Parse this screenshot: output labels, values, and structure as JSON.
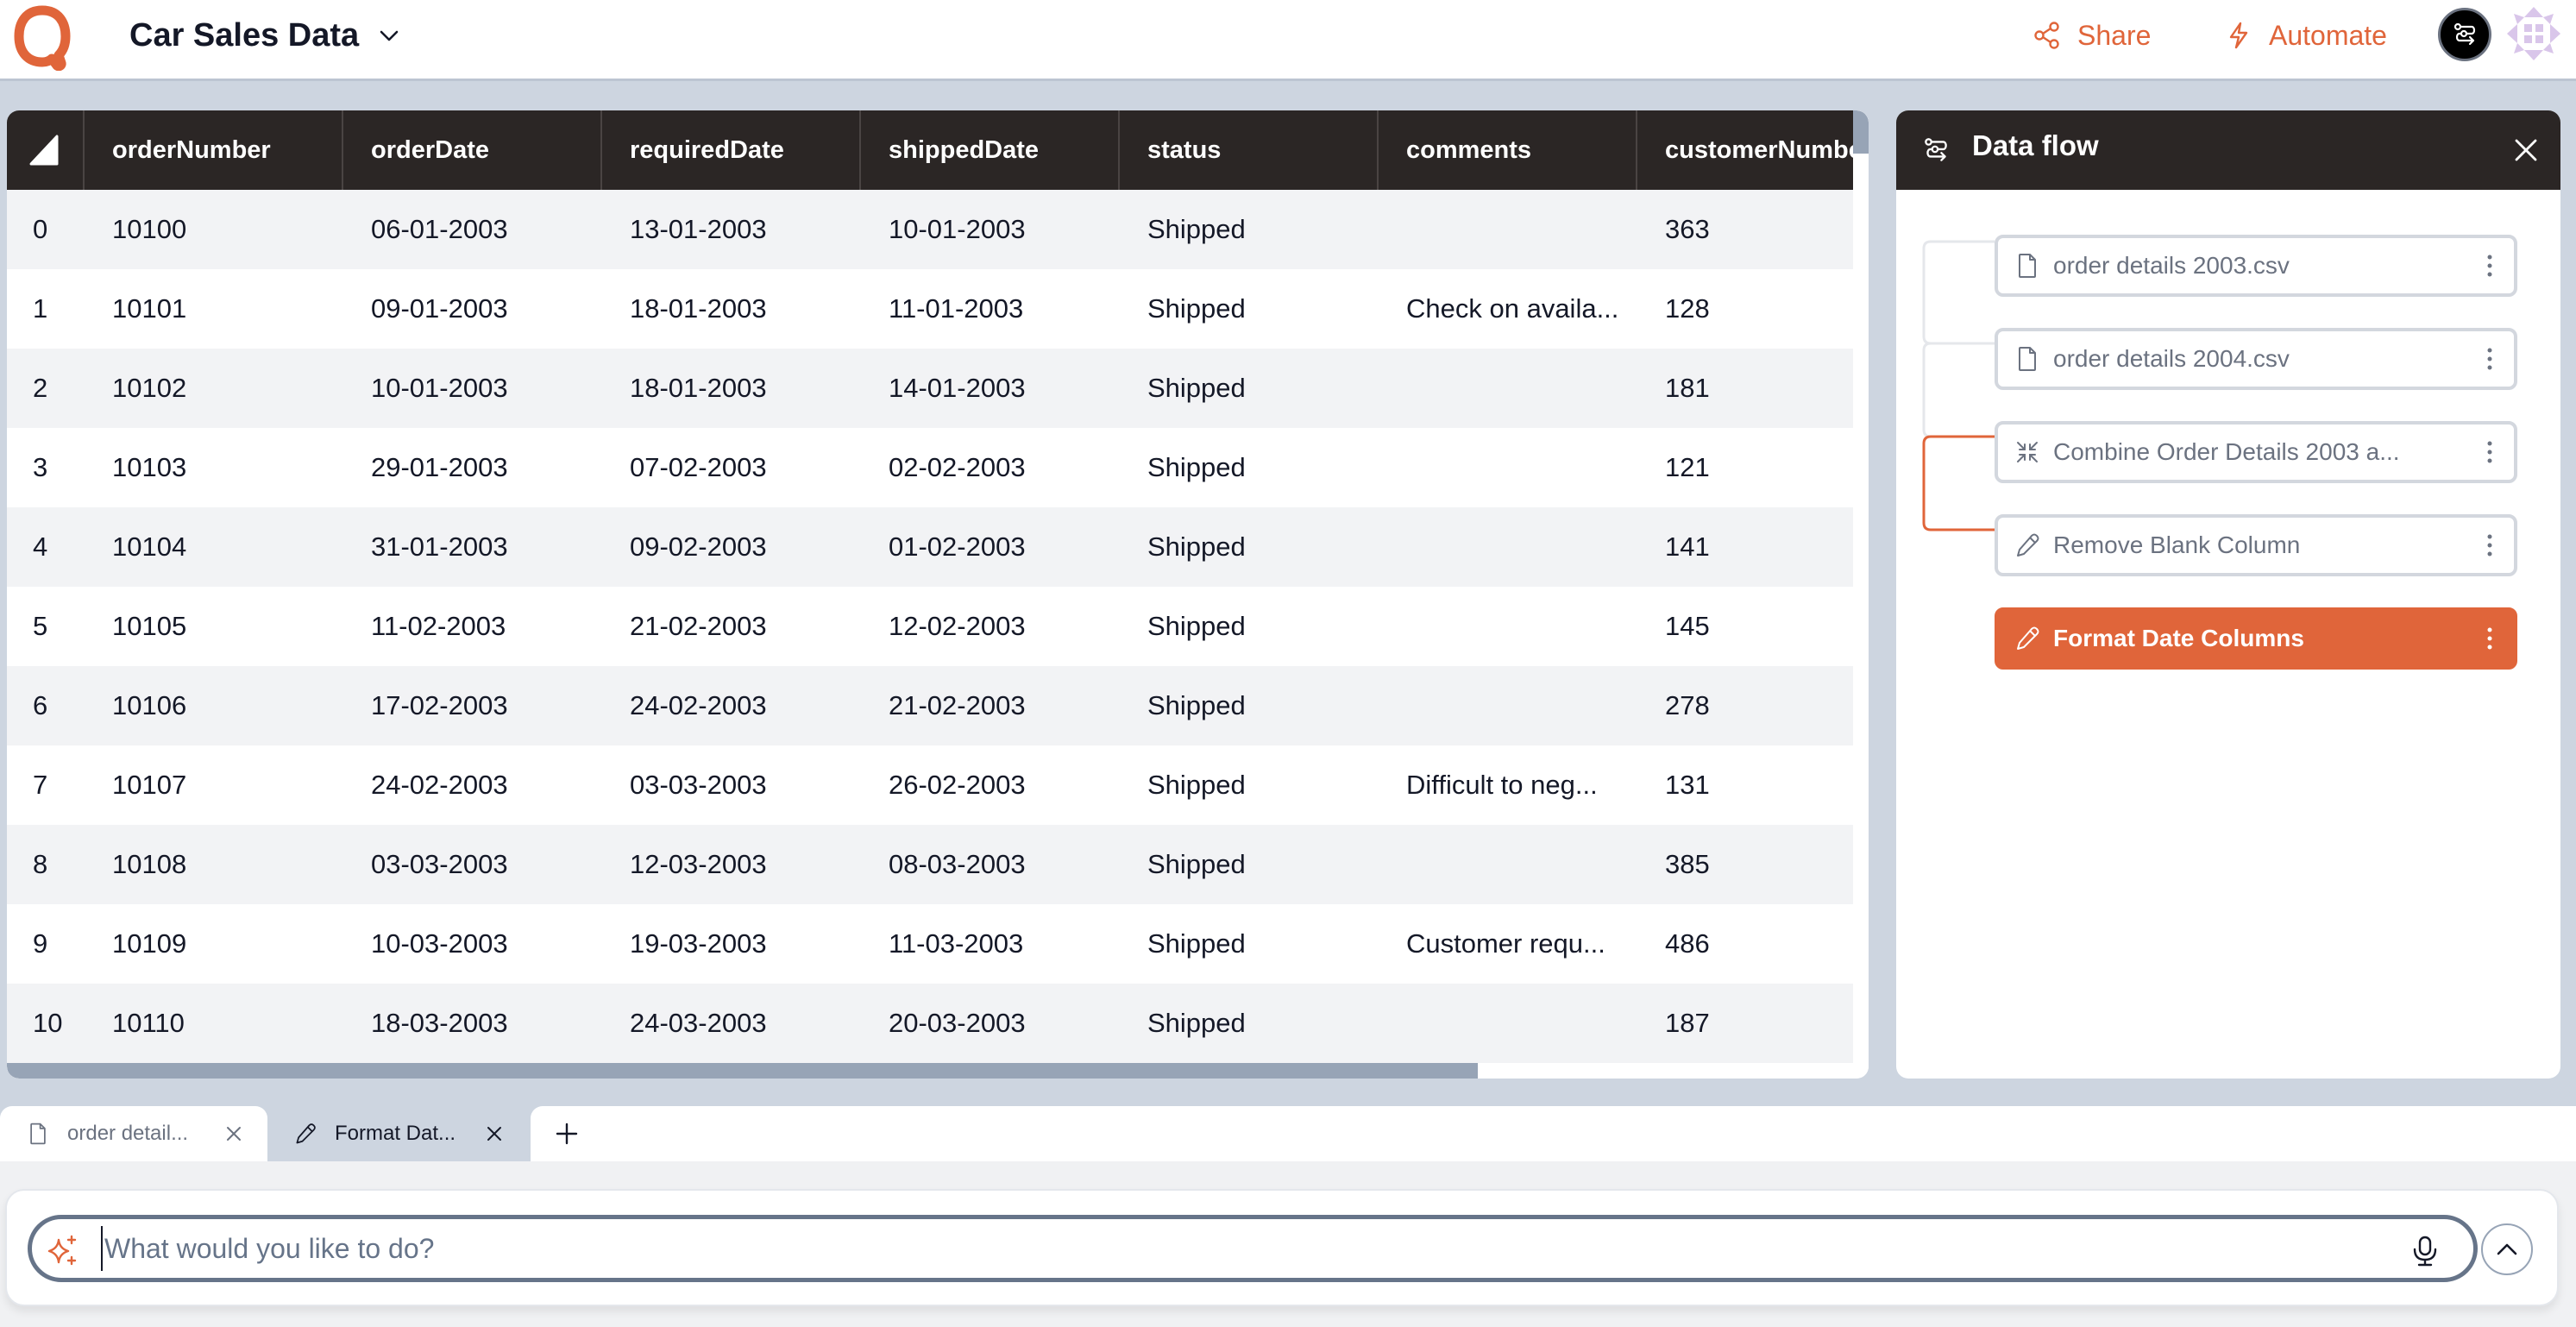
{
  "header": {
    "title": "Car Sales Data",
    "share_label": "Share",
    "automate_label": "Automate"
  },
  "colors": {
    "accent": "#e0653a",
    "header_dark": "#2b2625",
    "row_alt": "#f2f3f5",
    "page_bg": "#cdd5e0"
  },
  "table": {
    "columns": [
      "orderNumber",
      "orderDate",
      "requiredDate",
      "shippedDate",
      "status",
      "comments",
      "customerNumber"
    ],
    "rows": [
      {
        "index": "0",
        "orderNumber": "10100",
        "orderDate": "06-01-2003",
        "requiredDate": "13-01-2003",
        "shippedDate": "10-01-2003",
        "status": "Shipped",
        "comments": "",
        "customerNumber": "363"
      },
      {
        "index": "1",
        "orderNumber": "10101",
        "orderDate": "09-01-2003",
        "requiredDate": "18-01-2003",
        "shippedDate": "11-01-2003",
        "status": "Shipped",
        "comments": "Check on availa...",
        "customerNumber": "128"
      },
      {
        "index": "2",
        "orderNumber": "10102",
        "orderDate": "10-01-2003",
        "requiredDate": "18-01-2003",
        "shippedDate": "14-01-2003",
        "status": "Shipped",
        "comments": "",
        "customerNumber": "181"
      },
      {
        "index": "3",
        "orderNumber": "10103",
        "orderDate": "29-01-2003",
        "requiredDate": "07-02-2003",
        "shippedDate": "02-02-2003",
        "status": "Shipped",
        "comments": "",
        "customerNumber": "121"
      },
      {
        "index": "4",
        "orderNumber": "10104",
        "orderDate": "31-01-2003",
        "requiredDate": "09-02-2003",
        "shippedDate": "01-02-2003",
        "status": "Shipped",
        "comments": "",
        "customerNumber": "141"
      },
      {
        "index": "5",
        "orderNumber": "10105",
        "orderDate": "11-02-2003",
        "requiredDate": "21-02-2003",
        "shippedDate": "12-02-2003",
        "status": "Shipped",
        "comments": "",
        "customerNumber": "145"
      },
      {
        "index": "6",
        "orderNumber": "10106",
        "orderDate": "17-02-2003",
        "requiredDate": "24-02-2003",
        "shippedDate": "21-02-2003",
        "status": "Shipped",
        "comments": "",
        "customerNumber": "278"
      },
      {
        "index": "7",
        "orderNumber": "10107",
        "orderDate": "24-02-2003",
        "requiredDate": "03-03-2003",
        "shippedDate": "26-02-2003",
        "status": "Shipped",
        "comments": "Difficult to neg...",
        "customerNumber": "131"
      },
      {
        "index": "8",
        "orderNumber": "10108",
        "orderDate": "03-03-2003",
        "requiredDate": "12-03-2003",
        "shippedDate": "08-03-2003",
        "status": "Shipped",
        "comments": "",
        "customerNumber": "385"
      },
      {
        "index": "9",
        "orderNumber": "10109",
        "orderDate": "10-03-2003",
        "requiredDate": "19-03-2003",
        "shippedDate": "11-03-2003",
        "status": "Shipped",
        "comments": "Customer requ...",
        "customerNumber": "486"
      },
      {
        "index": "10",
        "orderNumber": "10110",
        "orderDate": "18-03-2003",
        "requiredDate": "24-03-2003",
        "shippedDate": "20-03-2003",
        "status": "Shipped",
        "comments": "",
        "customerNumber": "187"
      }
    ]
  },
  "data_flow": {
    "title": "Data flow",
    "nodes": [
      {
        "label": "order details 2003.csv",
        "icon": "file-icon",
        "active": false
      },
      {
        "label": "order details 2004.csv",
        "icon": "file-icon",
        "active": false
      },
      {
        "label": "Combine Order Details 2003 a...",
        "icon": "combine-icon",
        "active": false
      },
      {
        "label": "Remove Blank Column",
        "icon": "pencil-icon",
        "active": false
      },
      {
        "label": "Format Date Columns",
        "icon": "pencil-icon",
        "active": true
      }
    ]
  },
  "tabs": [
    {
      "label": "order detail...",
      "icon": "file-icon",
      "active": false
    },
    {
      "label": "Format Dat...",
      "icon": "pencil-icon",
      "active": true
    }
  ],
  "prompt": {
    "placeholder": "What would you like to do?",
    "value": ""
  }
}
